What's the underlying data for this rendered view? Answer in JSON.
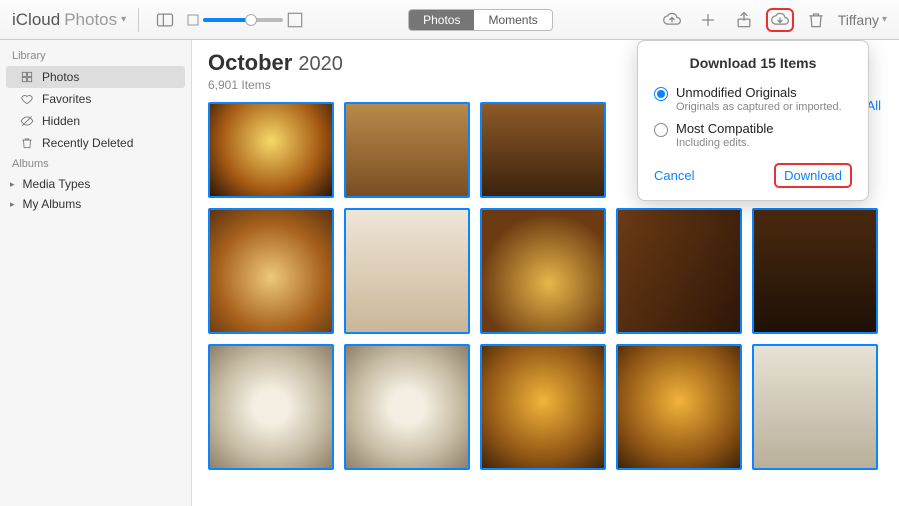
{
  "header": {
    "app": "iCloud",
    "section": "Photos",
    "tabs": [
      "Photos",
      "Moments"
    ],
    "active_tab": 0,
    "user": "Tiffany"
  },
  "sidebar": {
    "groups": [
      {
        "title": "Library",
        "items": [
          {
            "icon": "photos-icon",
            "label": "Photos",
            "selected": true
          },
          {
            "icon": "heart-icon",
            "label": "Favorites"
          },
          {
            "icon": "eye-off-icon",
            "label": "Hidden"
          },
          {
            "icon": "trash-icon",
            "label": "Recently Deleted"
          }
        ]
      },
      {
        "title": "Albums",
        "items": [
          {
            "icon": "stack-icon",
            "label": "Media Types",
            "expandable": true
          },
          {
            "icon": "stack-icon",
            "label": "My Albums",
            "expandable": true
          }
        ]
      }
    ]
  },
  "content": {
    "month": "October",
    "year": "2020",
    "count_label": "6,901 Items",
    "select_all": "ct All"
  },
  "popover": {
    "title": "Download 15 Items",
    "options": [
      {
        "title": "Unmodified Originals",
        "sub": "Originals as captured or imported.",
        "selected": true
      },
      {
        "title": "Most Compatible",
        "sub": "Including edits.",
        "selected": false
      }
    ],
    "cancel": "Cancel",
    "download": "Download"
  }
}
